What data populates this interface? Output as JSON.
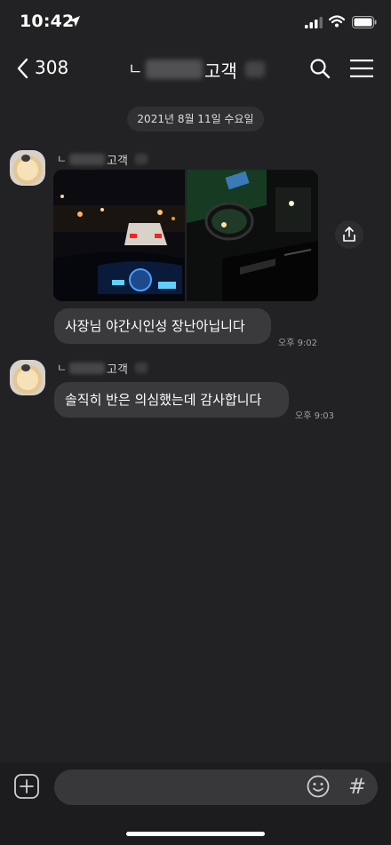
{
  "status_bar": {
    "time": "10:42",
    "icons": [
      "location-arrow-icon",
      "signal-icon",
      "wifi-icon",
      "battery-icon"
    ]
  },
  "header": {
    "back_count": "308",
    "title_prefix": "ㄴ",
    "title_suffix": "고객",
    "icons": [
      "back-chevron-icon",
      "search-icon",
      "menu-icon"
    ]
  },
  "date_divider": "2021년 8월 11일 수요일",
  "messages": [
    {
      "sender_prefix": "ㄴ",
      "sender_suffix": "고객",
      "photos": [
        "night-driving-dashboard-photo",
        "night-side-mirror-photo"
      ],
      "text": "사장님 야간시인성 장난아닙니다",
      "time": "오후 9:02"
    },
    {
      "sender_prefix": "ㄴ",
      "sender_suffix": "고객",
      "text": "솔직히 반은 의심했는데 감사합니다",
      "time": "오후 9:03"
    }
  ],
  "input_bar": {
    "placeholder": "",
    "icons": [
      "add-icon",
      "emoji-icon",
      "hash-icon"
    ],
    "hash_symbol": "#"
  },
  "colors": {
    "background": "#222224",
    "bubble": "#3a3a3c",
    "input_bar": "#1c1c1e"
  }
}
